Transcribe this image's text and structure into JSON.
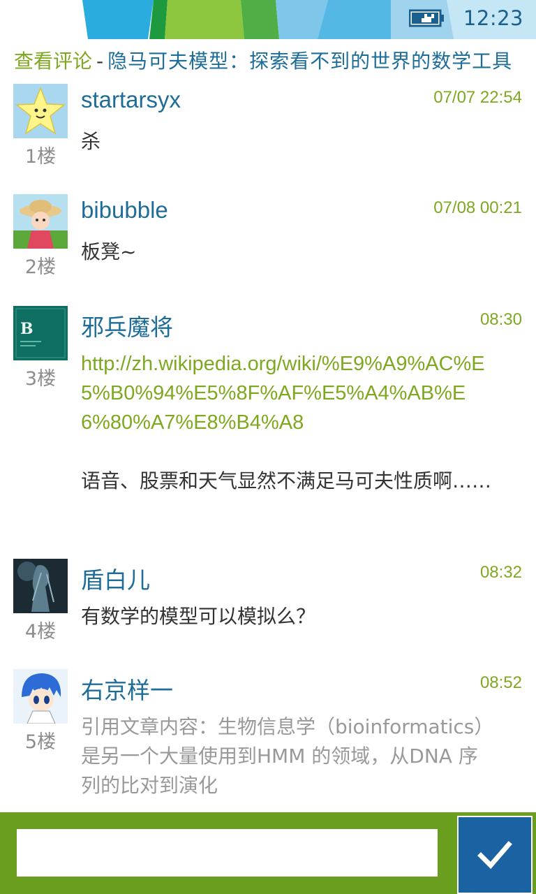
{
  "status_bar": {
    "time": "12:23",
    "battery_icon": "battery-charging-icon",
    "stripe_colors": [
      "#7fc7ea",
      "#2bacde",
      "#1e9a3e",
      "#8cc63e",
      "#4fae45",
      "#7fc7ea",
      "#55b8e4",
      "#b4ddf1"
    ]
  },
  "header": {
    "section": "查看评论",
    "separator": "-",
    "article_title": "隐马可夫模型：探索看不到的世界的数学工具"
  },
  "comments": [
    {
      "username": "startarsyx",
      "time": "07/07 22:54",
      "floor": "1楼",
      "avatar": "star-avatar",
      "text": "杀"
    },
    {
      "username": "bibubble",
      "time": "07/08 00:21",
      "floor": "2楼",
      "avatar": "girl-hat-avatar",
      "text": "板凳~"
    },
    {
      "username": "邪兵魔将",
      "time": "08:30",
      "floor": "3楼",
      "avatar": "book-cover-avatar",
      "link": "http://zh.wikipedia.org/wiki/%E9%A9%AC%E5%B0%94%E5%8F%AF%E5%A4%AB%E6%80%A7%E8%B4%A8",
      "text": "语音、股票和天气显然不满足马可夫性质啊……"
    },
    {
      "username": "盾白儿",
      "time": "08:32",
      "floor": "4楼",
      "avatar": "dark-figure-avatar",
      "text": "有数学的模型可以模拟么？"
    },
    {
      "username": "右京样一",
      "time": "08:52",
      "floor": "5楼",
      "avatar": "anime-boy-avatar",
      "quote": "引用文章内容：生物信息学（bioinformatics）是另一个大量使用到HMM 的领域，从DNA 序列的比对到演化"
    }
  ],
  "input": {
    "value": "",
    "placeholder": ""
  },
  "send_button": {
    "icon": "checkmark-icon",
    "color": "#1a62a1"
  },
  "colors": {
    "accent_green": "#7ea820",
    "accent_blue": "#1e6d99",
    "bar_green": "#6a9e1f"
  }
}
